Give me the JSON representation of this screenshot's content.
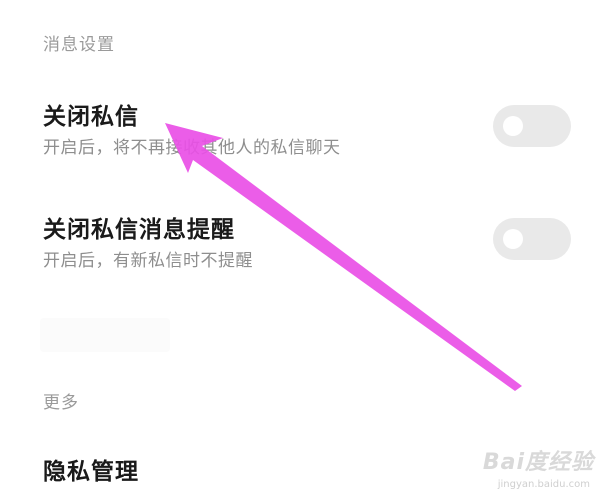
{
  "sections": {
    "message_settings_header": "消息设置",
    "more_header": "更多"
  },
  "settings": [
    {
      "title": "关闭私信",
      "description": "开启后，将不再接收其他人的私信聊天",
      "enabled": false
    },
    {
      "title": "关闭私信消息提醒",
      "description": "开启后，有新私信时不提醒",
      "enabled": false
    }
  ],
  "more_items": [
    {
      "label": "隐私管理"
    }
  ],
  "annotation": {
    "arrow_color": "#e94fe6"
  },
  "watermark": {
    "brand": "Bai度经验",
    "url": "jingyan.baidu.com"
  },
  "colors": {
    "background": "#ffffff",
    "title_text": "#1a1a1a",
    "secondary_text": "#8e8e8e",
    "toggle_off": "#e9e9e9"
  }
}
